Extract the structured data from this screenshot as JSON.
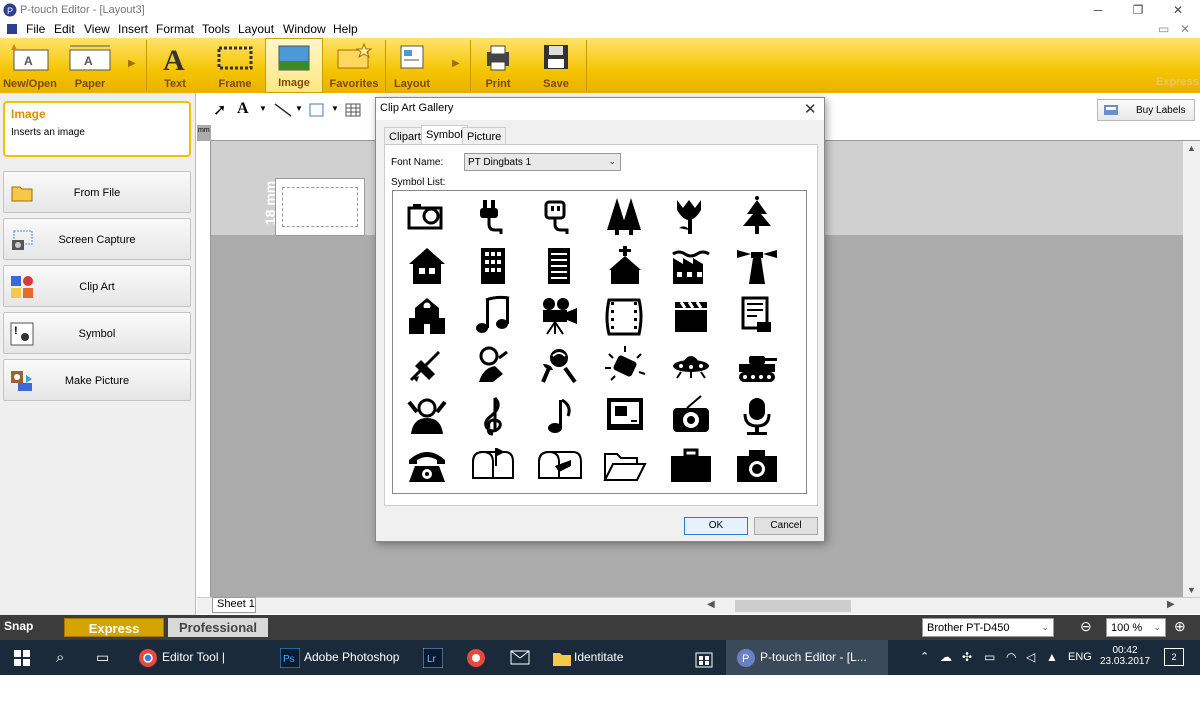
{
  "app": {
    "title": "P-touch Editor - [Layout3]",
    "express_watermark": "Express"
  },
  "menu": [
    "File",
    "Edit",
    "View",
    "Insert",
    "Format",
    "Tools",
    "Layout",
    "Window",
    "Help"
  ],
  "ribbon": {
    "new_open": "New/Open",
    "paper": "Paper",
    "text": "Text",
    "frame": "Frame",
    "image": "Image",
    "favorites": "Favorites",
    "layout": "Layout",
    "print": "Print",
    "save": "Save"
  },
  "left_panel": {
    "info_title": "Image",
    "info_desc": "Inserts an image",
    "buttons": [
      "From File",
      "Screen Capture",
      "Clip Art",
      "Symbol",
      "Make Picture"
    ]
  },
  "buy_labels": "Buy Labels",
  "canvas": {
    "label_size": "18 mm",
    "sheet_tab": "Sheet 1"
  },
  "status": {
    "snap": "Snap",
    "express": "Express",
    "professional": "Professional",
    "printer": "Brother PT-D450",
    "zoom": "100 %"
  },
  "dialog": {
    "title": "Clip Art Gallery",
    "tabs": [
      "Clipart",
      "Symbol",
      "Picture"
    ],
    "font_label": "Font Name:",
    "font_value": "PT Dingbats 1",
    "symbol_list_label": "Symbol List:",
    "ok": "OK",
    "cancel": "Cancel",
    "symbols": [
      "camera-photo",
      "plug",
      "plug-socket",
      "forest",
      "tulip",
      "christmas-tree",
      "house",
      "office-building",
      "document",
      "church",
      "factory",
      "lighthouse",
      "school",
      "music-note-double",
      "film-camera",
      "film-strip",
      "clapperboard",
      "script",
      "fencer",
      "bowler",
      "rose",
      "candy",
      "ufo",
      "tank",
      "crowd-cheering",
      "treble-clef",
      "music-note",
      "monitor",
      "radio",
      "microphone",
      "telephone",
      "mailbox-flag",
      "mailbox-letter",
      "folder-open",
      "briefcase",
      "camera"
    ]
  },
  "taskbar": {
    "apps": [
      "Editor Tool | Downl...",
      "Adobe Photoshop ...",
      "Identitate",
      "P-touch Editor - [L..."
    ],
    "lang": "ENG",
    "time": "00:42",
    "date": "23.03.2017",
    "notif_count": "2"
  },
  "colors": {
    "ribbon": "#f5c400",
    "express_active": "#d6a400",
    "taskbar": "#1a2a3a"
  }
}
